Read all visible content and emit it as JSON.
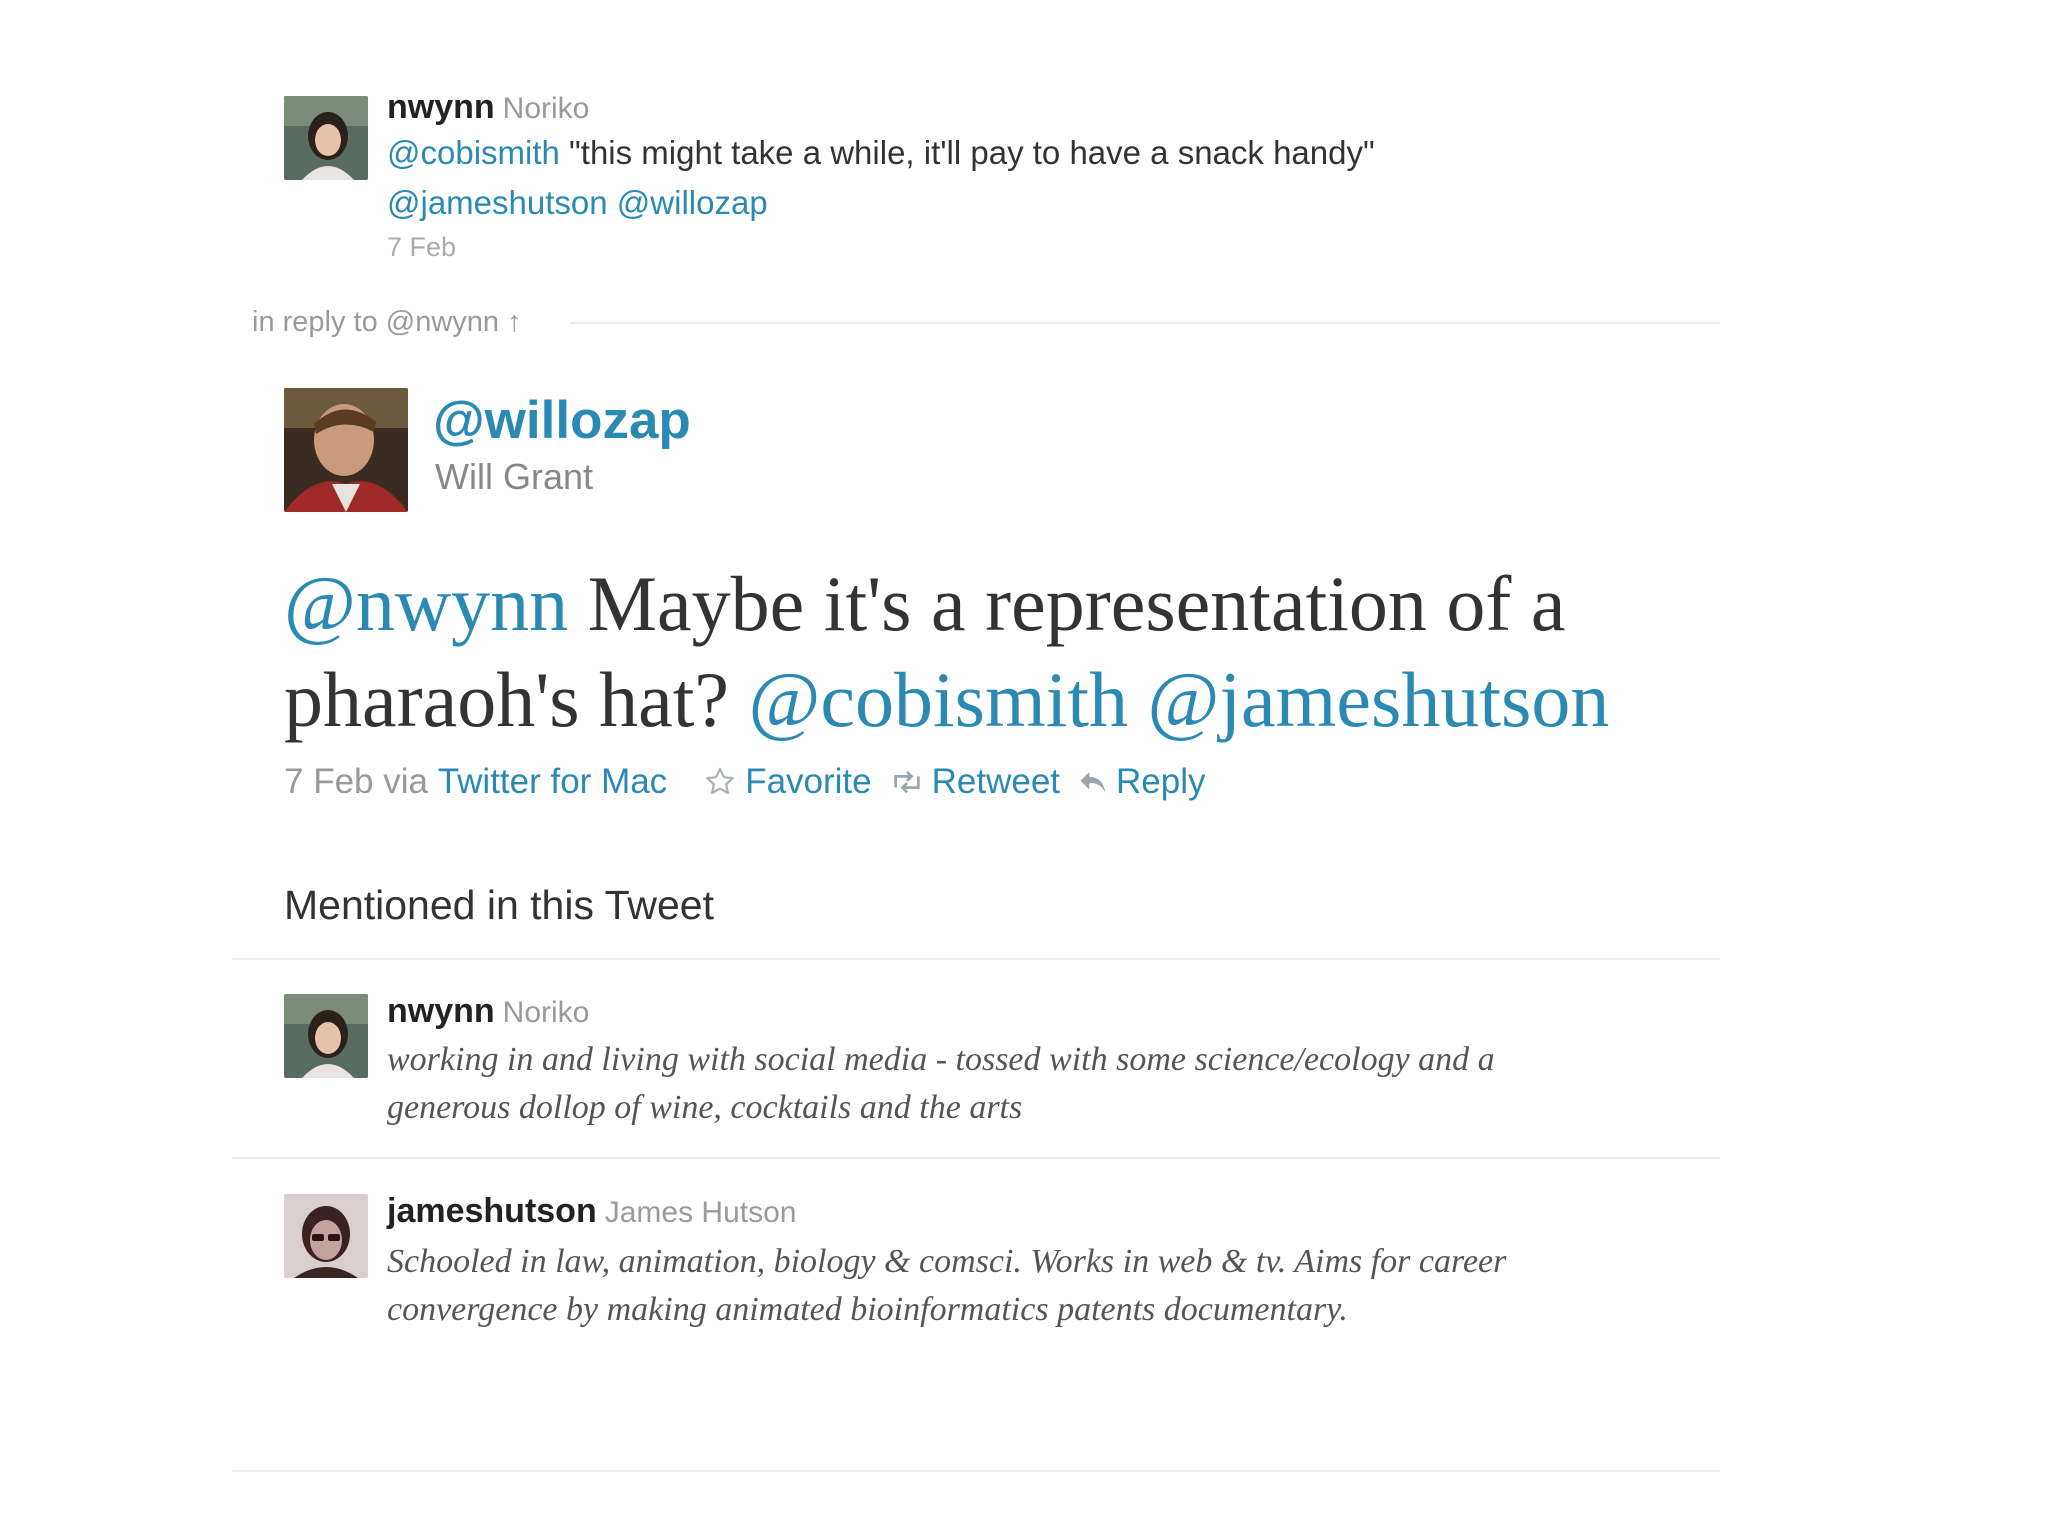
{
  "top_tweet": {
    "username": "nwynn",
    "fullname": "Noriko",
    "mention1": "@cobismith",
    "text": " \"this might take a while, it'll pay to have a snack handy\" ",
    "mention2": "@jameshutson",
    "mention3": "@willozap",
    "time": "7 Feb"
  },
  "in_reply": {
    "label": "in reply to @nwynn",
    "arrow": "↑"
  },
  "main_tweet": {
    "handle": "@willozap",
    "name": "Will Grant",
    "mention1": "@nwynn",
    "text1": " Maybe it's a representation of a pharaoh's hat? ",
    "mention2": "@cobismith",
    "mention3": "@jameshutson",
    "date_via": "7 Feb via ",
    "client": "Twitter for Mac",
    "actions": {
      "favorite": "Favorite",
      "retweet": "Retweet",
      "reply": "Reply"
    }
  },
  "mentioned": {
    "title": "Mentioned in this Tweet",
    "users": [
      {
        "username": "nwynn",
        "fullname": "Noriko",
        "bio": "working in and living with social media - tossed with some science/ecology and a generous dollop of wine, cocktails and the arts"
      },
      {
        "username": "jameshutson",
        "fullname": "James Hutson",
        "bio": "Schooled in law, animation, biology & comsci. Works in web & tv. Aims for career convergence by making animated bioinformatics patents documentary."
      }
    ]
  },
  "colors": {
    "link": "#2b8ab4",
    "muted": "#999999",
    "text": "#333333",
    "divider": "#ececec"
  },
  "icons": {
    "favorite": "star-icon",
    "retweet": "retweet-icon",
    "reply": "reply-arrow-icon"
  }
}
